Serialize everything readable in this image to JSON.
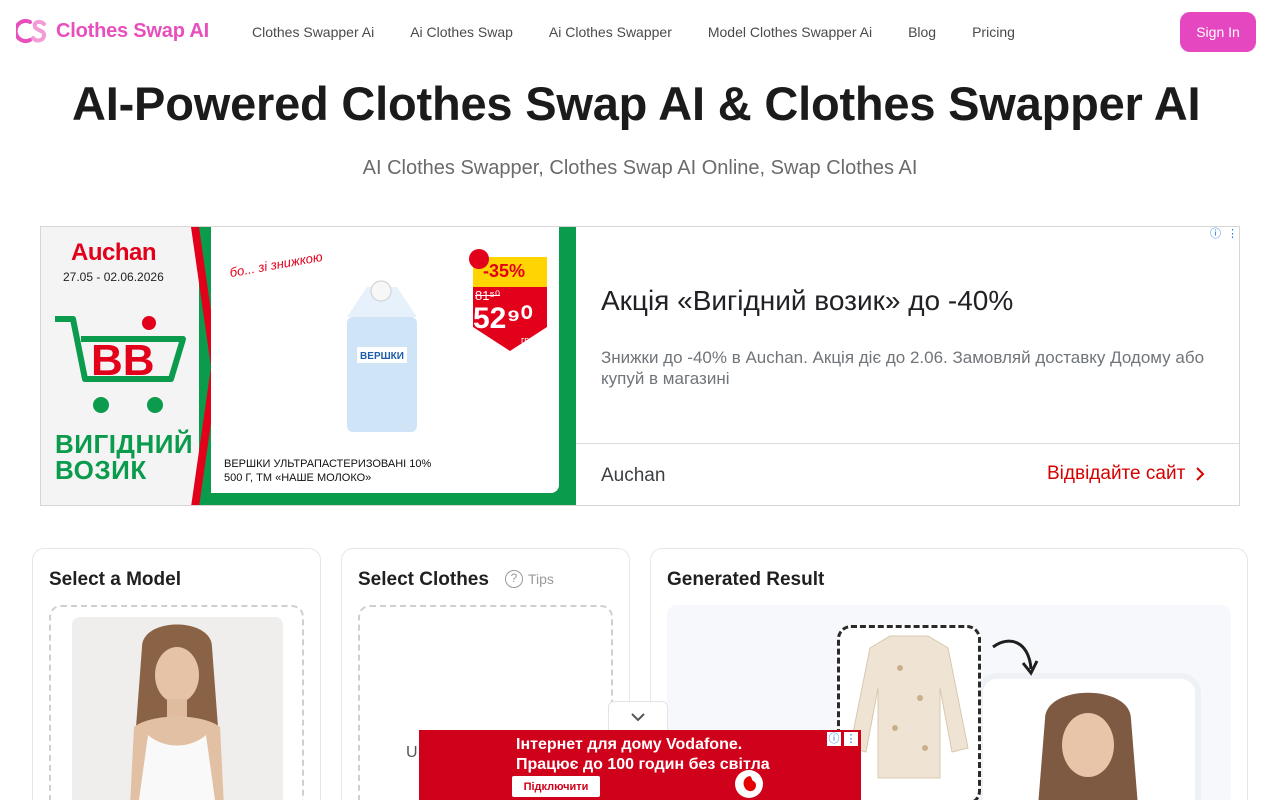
{
  "nav": {
    "logo_text": "Clothes Swap AI",
    "links": [
      "Clothes Swapper Ai",
      "Ai Clothes Swap",
      "Ai Clothes Swapper",
      "Model Clothes Swapper Ai",
      "Blog",
      "Pricing"
    ],
    "sign_in": "Sign In",
    "brand_color": "#e547c0"
  },
  "hero": {
    "title": "AI-Powered Clothes Swap AI & Clothes Swapper AI",
    "subtitle": "AI Clothes Swapper, Clothes Swap AI Online, Swap Clothes AI"
  },
  "ad_banner": {
    "brand": "Auchan",
    "dates": "27.05 - 02.06.2026",
    "campaign_logo": "ВИГІДНИЙ ВОЗИК",
    "tagline": "бо... зі знижкою",
    "discount": "-35%",
    "old_price": "81⁵⁰",
    "new_price": "52⁹⁰",
    "currency": "грн",
    "product_name": "ВЕРШКИ УЛЬТРАПАСТЕРИЗОВАНІ 10%",
    "product_details": "500 Г, ТМ «НАШЕ МОЛОКО»",
    "headline": "Акція «Вигідний возик» до -40%",
    "description": "Знижки до -40% в Auchan. Акція діє до 2.06. Замовляй доставку Додому або купуй в магазині",
    "advertiser": "Auchan",
    "cta": "Відвідайте сайт"
  },
  "panels": {
    "model": {
      "title": "Select a Model"
    },
    "clothes": {
      "title": "Select Clothes",
      "tips": "Tips",
      "upload_partial": "U"
    },
    "result": {
      "title": "Generated Result"
    }
  },
  "bottom_ad": {
    "line1": "Інтернет для дому Vodafone.",
    "line2": "Працює до 100 годин без світла",
    "button": "Підключити"
  }
}
